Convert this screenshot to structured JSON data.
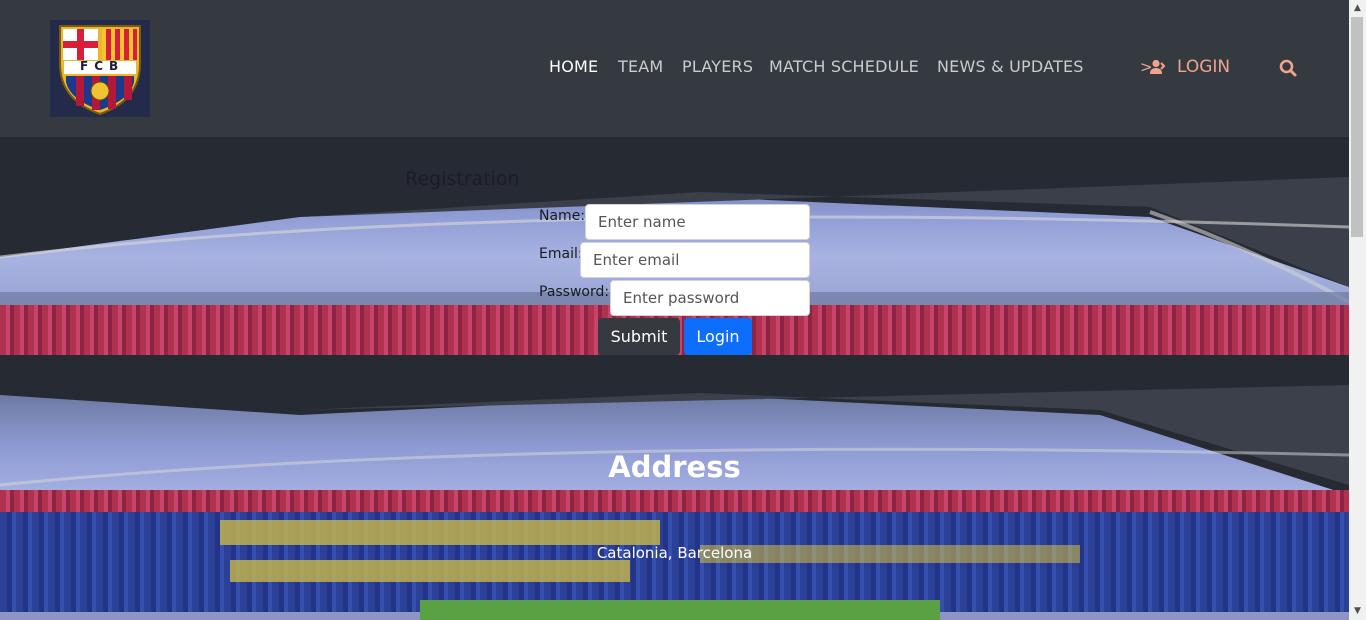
{
  "brand": {
    "logo_text": "FCB"
  },
  "nav": {
    "items": [
      {
        "label": "HOME",
        "active": true
      },
      {
        "label": "TEAM"
      },
      {
        "label": "PLAYERS"
      },
      {
        "label": "MATCH SCHEDULE"
      },
      {
        "label": "NEWS & UPDATES"
      }
    ],
    "login_chevron": ">",
    "login_label": "LOGIN",
    "login_icon": "user-icon",
    "search_icon": "search-icon"
  },
  "form": {
    "title": "Registration",
    "name_label": "Name:",
    "name_placeholder": "Enter name",
    "email_label": "Email:",
    "email_placeholder": "Enter email",
    "password_label": "Password:",
    "password_placeholder": "Enter password",
    "submit_label": "Submit",
    "login_label": "Login"
  },
  "address": {
    "title": "Address",
    "text": "Catalonia, Barcelona"
  },
  "colors": {
    "header_bg": "#343a40",
    "accent_login": "#f0a48c",
    "primary_button": "#0d6efd",
    "dark_button": "#343a40"
  }
}
